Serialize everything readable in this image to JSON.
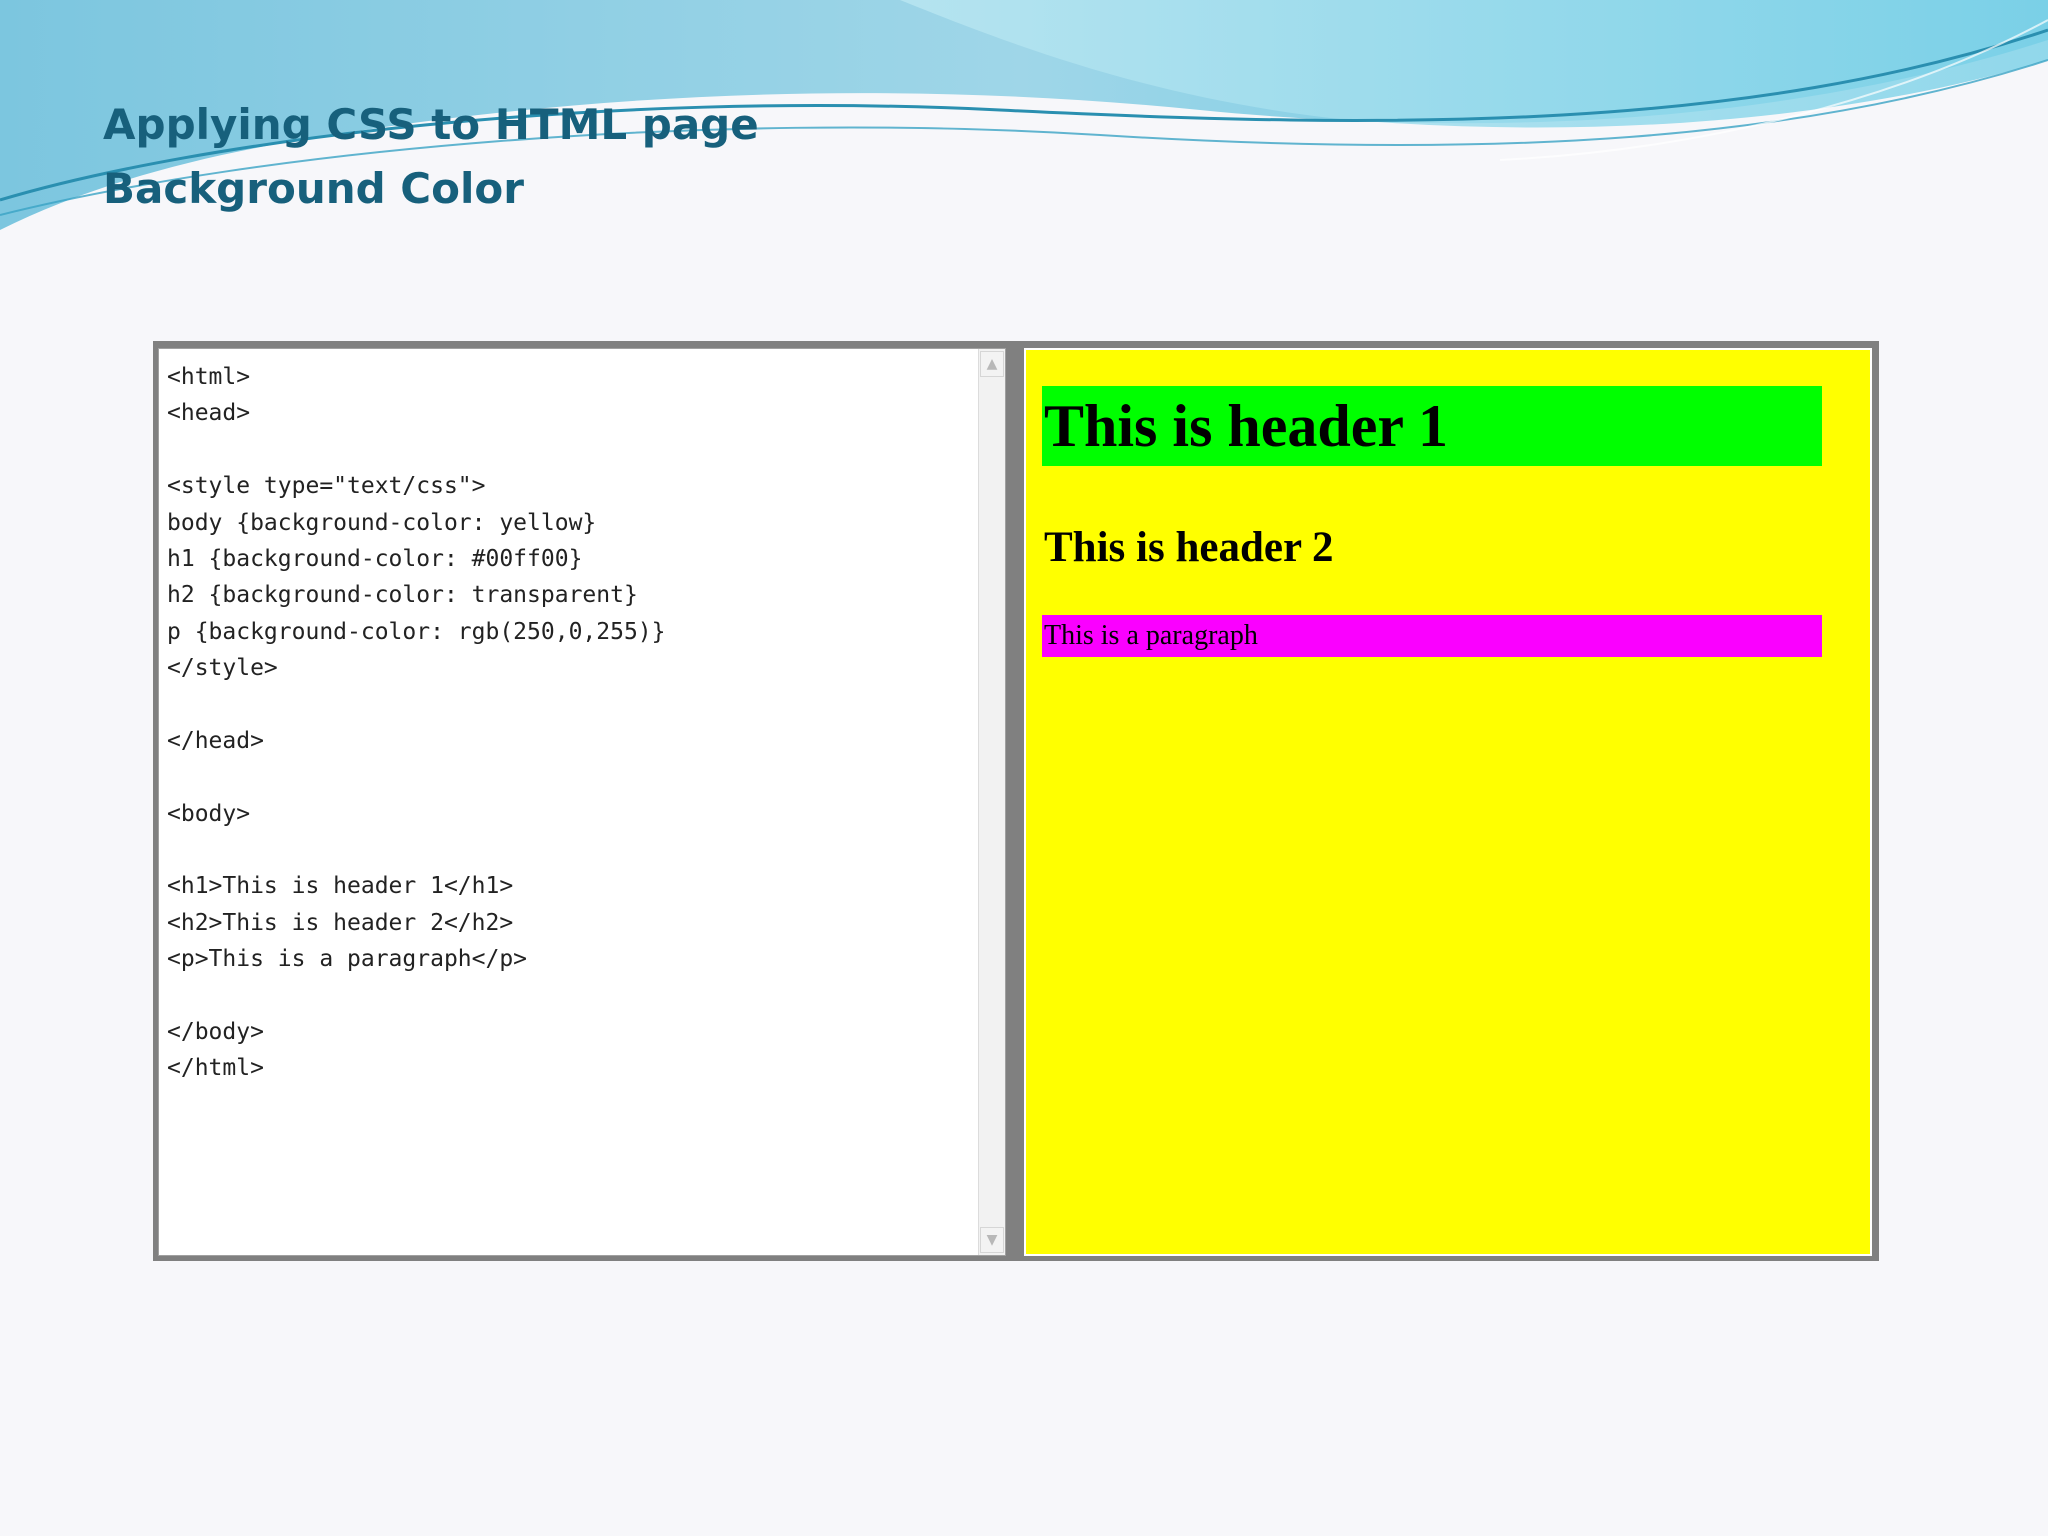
{
  "slide": {
    "title": "Applying CSS to HTML page",
    "subtitle": "Background Color"
  },
  "code_panel": {
    "lines": [
      "<html>",
      "<head>",
      "",
      "<style type=\"text/css\">",
      "body {background-color: yellow}",
      "h1 {background-color: #00ff00}",
      "h2 {background-color: transparent}",
      "p {background-color: rgb(250,0,255)}",
      "</style>",
      "",
      "</head>",
      "",
      "<body>",
      "",
      "<h1>This is header 1</h1>",
      "<h2>This is header 2</h2>",
      "<p>This is a paragraph</p>",
      "",
      "</body>",
      "</html>"
    ]
  },
  "render_panel": {
    "h1_text": "This is header 1",
    "h2_text": "This is header 2",
    "p_text": "This is a paragraph",
    "body_bg": "#ffff00",
    "h1_bg": "#00ff00",
    "p_bg": "#fa00ff"
  },
  "icons": {
    "scroll_up": "scroll-up-arrow-icon",
    "scroll_down": "scroll-down-arrow-icon"
  },
  "colors": {
    "title": "#17607c",
    "wave_light": "#a8e0ee",
    "wave_mid": "#5fc3e0",
    "wave_dark": "#1f8fb8"
  }
}
